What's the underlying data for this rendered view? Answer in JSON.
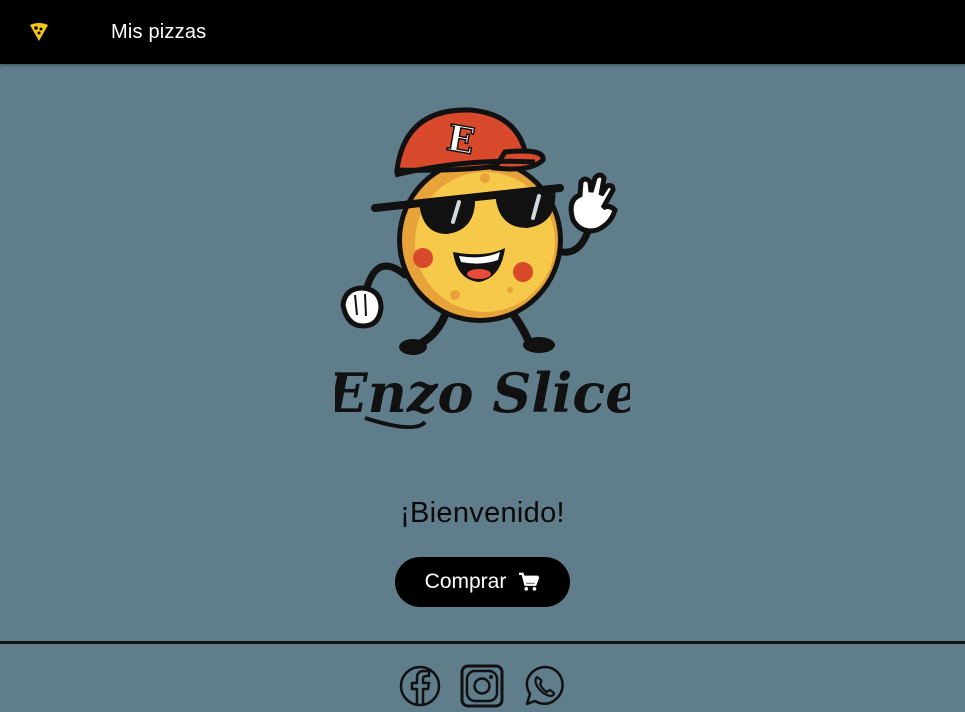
{
  "appbar": {
    "menu_icon": "pizza-slice-icon",
    "title": "Mis pizzas"
  },
  "logo": {
    "text": "Enzo Slice",
    "cap_letter": "E"
  },
  "main": {
    "welcome": "¡Bienvenido!",
    "buy_label": "Comprar",
    "buy_icon": "cart-icon"
  },
  "footer": {
    "social": [
      "facebook-icon",
      "instagram-icon",
      "whatsapp-icon"
    ]
  },
  "colors": {
    "background": "#607d8b",
    "appbar": "#000000",
    "accent": "#f5c518",
    "button": "#000000"
  }
}
